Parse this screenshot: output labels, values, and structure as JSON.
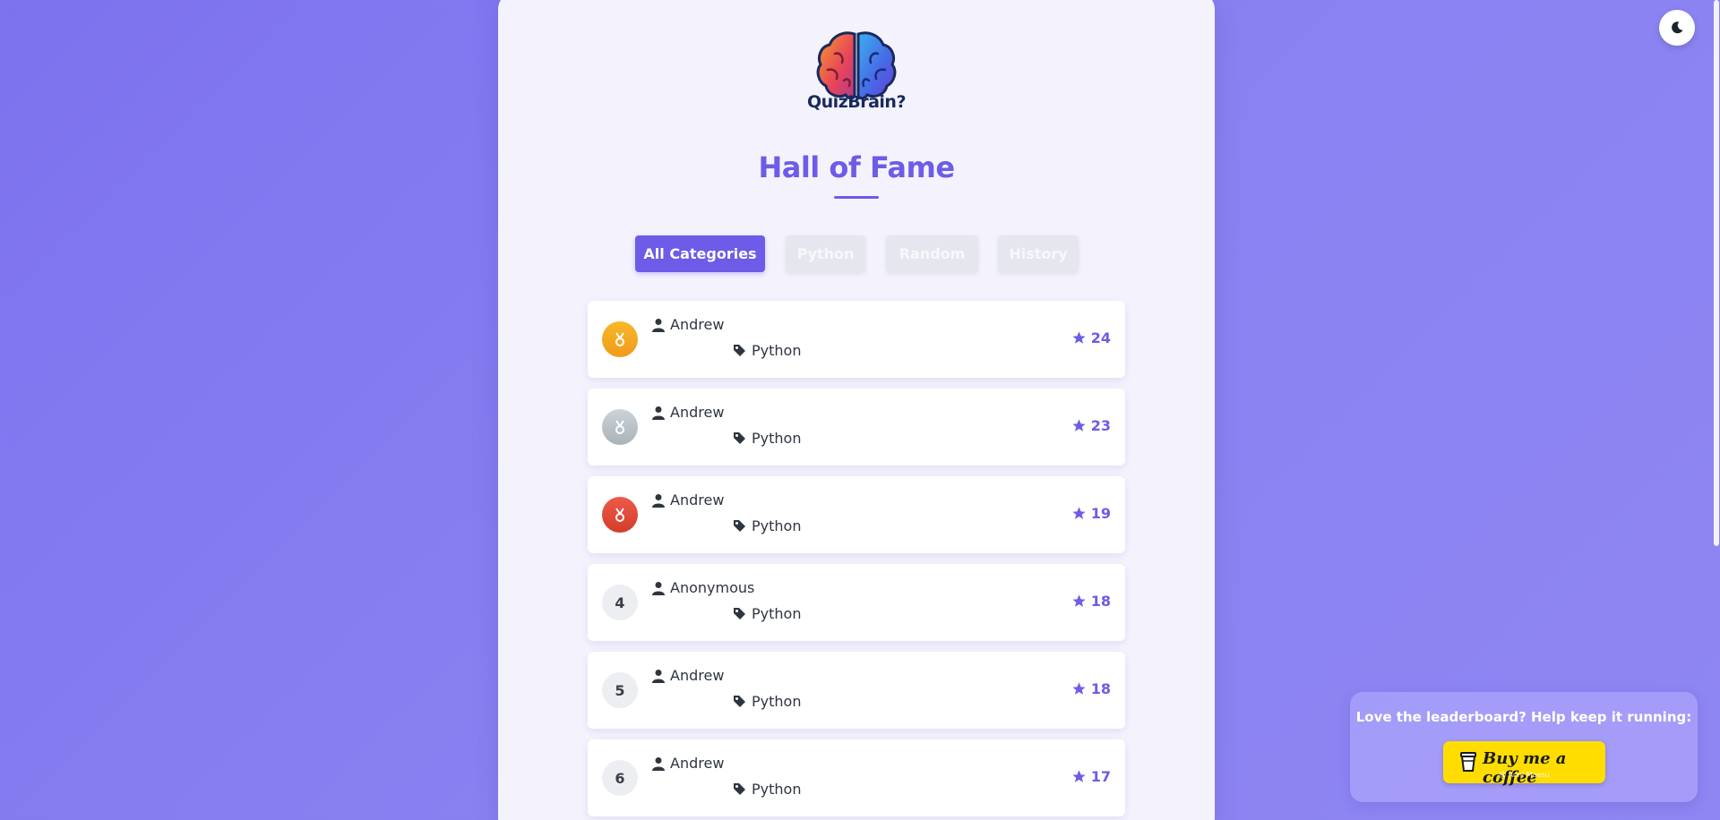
{
  "brand": {
    "name": "QuizBrain?"
  },
  "page": {
    "title": "Hall of Fame"
  },
  "filters": [
    {
      "label": "All Categories",
      "active": true
    },
    {
      "label": "Python",
      "active": false
    },
    {
      "label": "Random",
      "active": false
    },
    {
      "label": "History",
      "active": false
    }
  ],
  "leaderboard": [
    {
      "rank": "",
      "medal": "gold",
      "user": "Andrew",
      "category": "Python",
      "score": "24"
    },
    {
      "rank": "",
      "medal": "silver",
      "user": "Andrew",
      "category": "Python",
      "score": "23"
    },
    {
      "rank": "",
      "medal": "bronze",
      "user": "Andrew",
      "category": "Python",
      "score": "19"
    },
    {
      "rank": "4",
      "medal": "none",
      "user": "Anonymous",
      "category": "Python",
      "score": "18"
    },
    {
      "rank": "5",
      "medal": "none",
      "user": "Andrew",
      "category": "Python",
      "score": "18"
    },
    {
      "rank": "6",
      "medal": "none",
      "user": "Andrew",
      "category": "Python",
      "score": "17"
    }
  ],
  "support": {
    "message": "Love the leaderboard? Help keep it running:",
    "button_label": "Buy me a coffee",
    "button_credit": "@ Roni Maesu"
  },
  "theme_toggle": {
    "icon": "moon-icon"
  },
  "colors": {
    "accent": "#6c5ce7",
    "gold": "#f5a623",
    "silver": "#b8c0c6",
    "bronze": "#e04a3a",
    "coffee_yellow": "#ffdd00"
  }
}
